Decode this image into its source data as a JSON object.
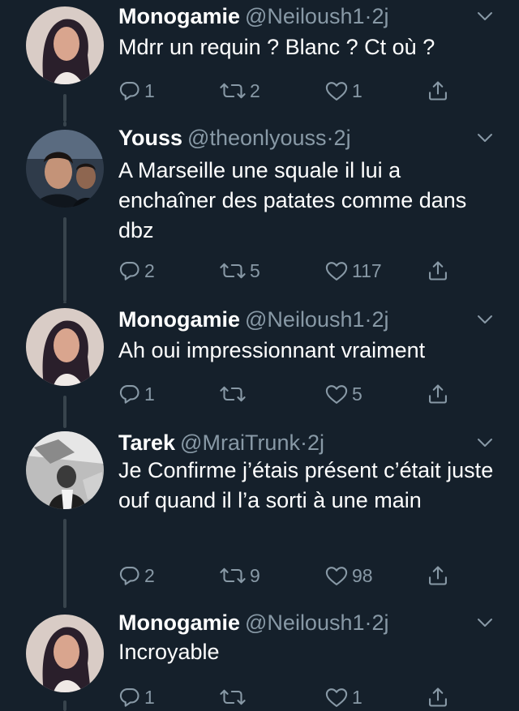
{
  "tweets": [
    {
      "name": "Monogamie",
      "handle": "@Neiloush1",
      "sep": "·",
      "time": "2j",
      "text": "Mdrr un requin ? Blanc ? Ct où ?",
      "replies": "1",
      "retweets": "2",
      "likes": "1",
      "avatar": "profile-photo-woman"
    },
    {
      "name": "Youss",
      "handle": "@theonlyouss",
      "sep": "·",
      "time": "2j",
      "text": "A Marseille une squale il lui a enchaîner des patates comme dans dbz",
      "replies": "2",
      "retweets": "5",
      "likes": "117",
      "avatar": "profile-photo-two-men"
    },
    {
      "name": "Monogamie",
      "handle": "@Neiloush1",
      "sep": "·",
      "time": "2j",
      "text": "Ah oui impressionnant vraiment",
      "replies": "1",
      "retweets": "",
      "likes": "5",
      "avatar": "profile-photo-woman"
    },
    {
      "name": "Tarek",
      "handle": "@MraiTrunk",
      "sep": "·",
      "time": "2j",
      "text": "Je Confirme j’étais présent c’était juste ouf quand il l’a sorti à une main",
      "replies": "2",
      "retweets": "9",
      "likes": "98",
      "avatar": "profile-photo-bw"
    },
    {
      "name": "Monogamie",
      "handle": "@Neiloush1",
      "sep": "·",
      "time": "2j",
      "text": "Incroyable",
      "replies": "1",
      "retweets": "",
      "likes": "1",
      "avatar": "profile-photo-woman"
    }
  ],
  "colors": {
    "background": "#15202b",
    "secondary_text": "#8899a6",
    "thread_line": "#38444d"
  },
  "icons": [
    "reply-icon",
    "retweet-icon",
    "like-icon",
    "share-icon",
    "chevron-down-icon"
  ]
}
